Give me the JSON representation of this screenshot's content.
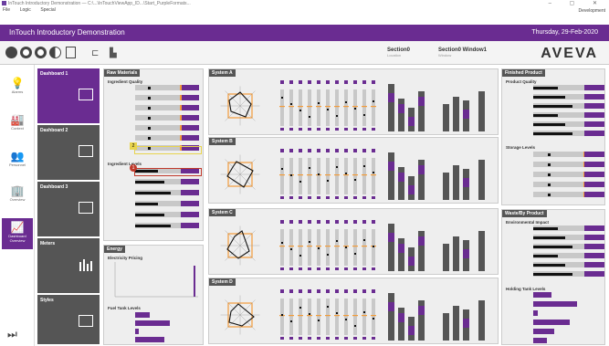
{
  "window": {
    "title": "InTouch Introductory Demonstration — C:\\...\\InTouchViewApp_ID...\\Start_PurpleFormats...",
    "controls": "– ▢ ✕",
    "menu": [
      "File",
      "Logic",
      "Special"
    ],
    "menu_right": "Development"
  },
  "header": {
    "title": "InTouch Introductory Demonstration",
    "date": "Thursday, 29-Feb-2020"
  },
  "toolbar": {
    "section1": {
      "title": "Section0",
      "sub": "Location"
    },
    "section2": {
      "title": "Section0 Window1",
      "sub": "Window"
    },
    "logo": "AVEVA"
  },
  "nav": [
    {
      "label": "Alarms",
      "icon": "bulb-icon",
      "glyph": "💡"
    },
    {
      "label": "Context",
      "icon": "factory-icon",
      "glyph": "🏭"
    },
    {
      "label": "Personnel",
      "icon": "people-icon",
      "glyph": "👥"
    },
    {
      "label": "Overview",
      "icon": "building-icon",
      "glyph": "🏢"
    },
    {
      "label": "Dashboard Overview",
      "icon": "dashboard-icon",
      "glyph": "📈"
    }
  ],
  "nav_bottom": "⏭",
  "dashboards": [
    {
      "label": "Dashboard 1",
      "active": true
    },
    {
      "label": "Dashboard 2",
      "active": false
    },
    {
      "label": "Dashboard 3",
      "active": false
    },
    {
      "label": "Meters",
      "active": false
    },
    {
      "label": "Styles",
      "active": false
    }
  ],
  "raw_materials": {
    "title": "Raw Materials",
    "group1": "Ingredient Quality",
    "group2": "Ingredient Levels",
    "callout1": "2",
    "callout2": "1"
  },
  "energy": {
    "title": "Energy",
    "sub": "Electricity Pricing",
    "sub2": "Fuel Tank Levels"
  },
  "systems": [
    {
      "title": "System A"
    },
    {
      "title": "System B"
    },
    {
      "title": "System C"
    },
    {
      "title": "System D"
    }
  ],
  "finished": {
    "title": "Finished Product",
    "sub1": "Product Quality",
    "sub2": "Storage Levels"
  },
  "waste": {
    "title": "Waste/By Product",
    "sub1": "Environmental Impact",
    "sub2": "Holding Tank Levels"
  },
  "colors": {
    "purple": "#6a2c91",
    "orange": "#f39c3a",
    "grey": "#555555"
  }
}
